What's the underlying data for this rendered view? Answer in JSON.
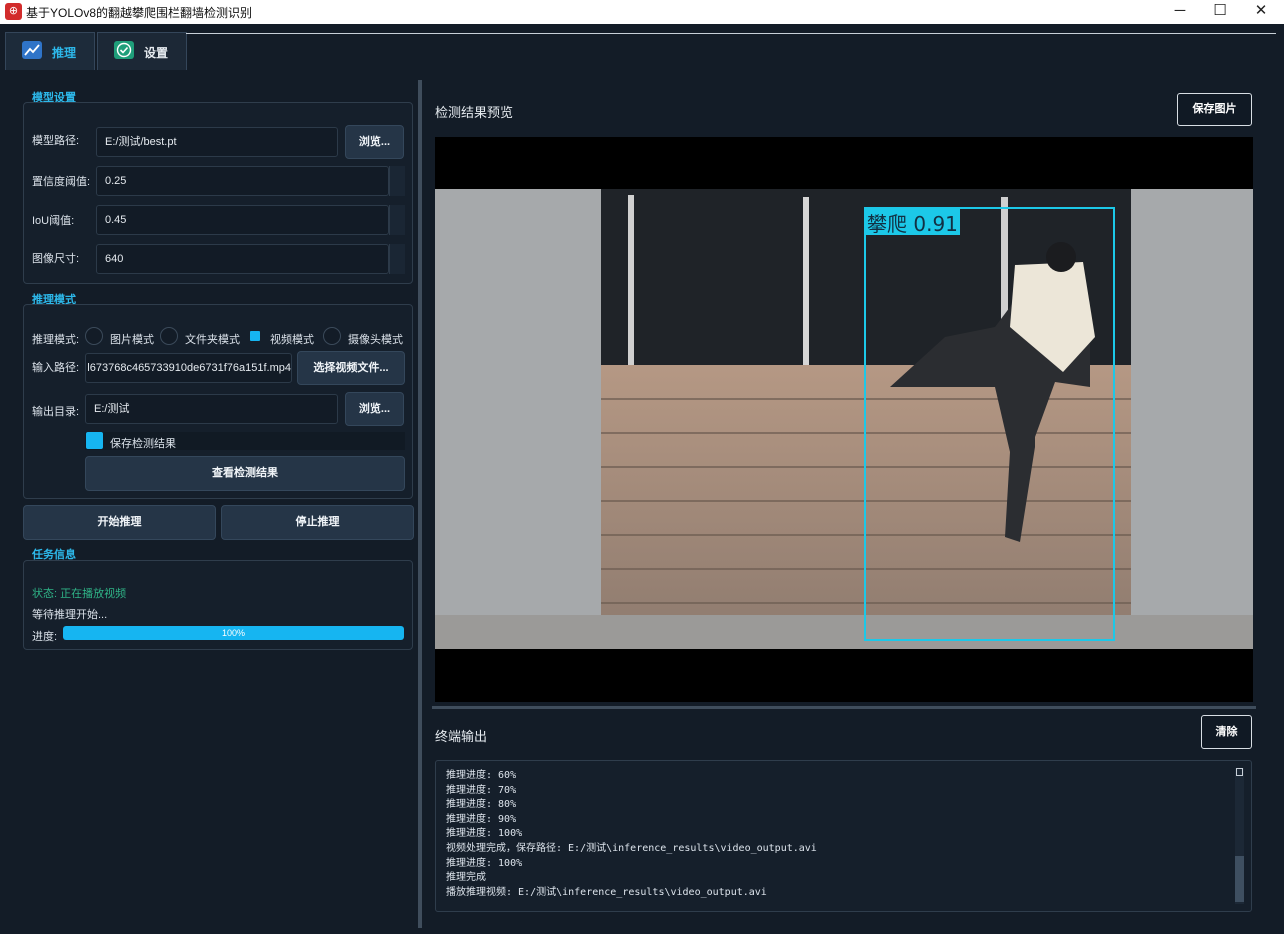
{
  "window": {
    "title": "基于YOLOv8的翻越攀爬围栏翻墙检测识别",
    "minimize": "─",
    "maximize": "☐",
    "close": "✕"
  },
  "tabs": [
    {
      "label": "推理",
      "icon": "chart-line-icon",
      "active": true
    },
    {
      "label": "设置",
      "icon": "check-badge-icon",
      "active": false
    }
  ],
  "model_settings": {
    "title": "模型设置",
    "path_label": "模型路径:",
    "path_value": "E:/测试/best.pt",
    "browse_label": "浏览...",
    "conf_label": "置信度阈值:",
    "conf_value": "0.25",
    "iou_label": "IoU阈值:",
    "iou_value": "0.45",
    "imgsz_label": "图像尺寸:",
    "imgsz_value": "640"
  },
  "inference_mode": {
    "title": "推理模式",
    "mode_label": "推理模式:",
    "modes": [
      "图片模式",
      "文件夹模式",
      "视频模式",
      "摄像头模式"
    ],
    "selected_mode": "视频模式",
    "input_label": "输入路径:",
    "input_value": "l673768c465733910de6731f76a151f.mp4",
    "select_video_label": "选择视频文件...",
    "output_label": "输出目录:",
    "output_value": "E:/测试",
    "browse_label": "浏览...",
    "save_results_label": "保存检测结果",
    "save_results_checked": true,
    "view_results_label": "查看检测结果"
  },
  "actions": {
    "start_label": "开始推理",
    "stop_label": "停止推理"
  },
  "task_info": {
    "title": "任务信息",
    "status_text": "状态: 正在播放视频",
    "wait_text": "等待推理开始...",
    "progress_label": "进度:",
    "progress_text": "100%",
    "progress_value": 100
  },
  "preview": {
    "title": "检测结果预览",
    "save_image_label": "保存图片",
    "detection_label": "攀爬 0.91"
  },
  "terminal": {
    "title": "终端输出",
    "clear_label": "清除",
    "lines": [
      "推理进度: 60%",
      "推理进度: 70%",
      "推理进度: 80%",
      "推理进度: 90%",
      "推理进度: 100%",
      "视频处理完成，保存路径: E:/测试\\inference_results\\video_output.avi",
      "推理进度: 100%",
      "推理完成",
      "播放推理视频: E:/测试\\inference_results\\video_output.avi"
    ]
  },
  "colors": {
    "accent": "#16b5f1",
    "section_title": "#2db8ea",
    "status_green": "#2fb487",
    "background": "#131c27"
  }
}
